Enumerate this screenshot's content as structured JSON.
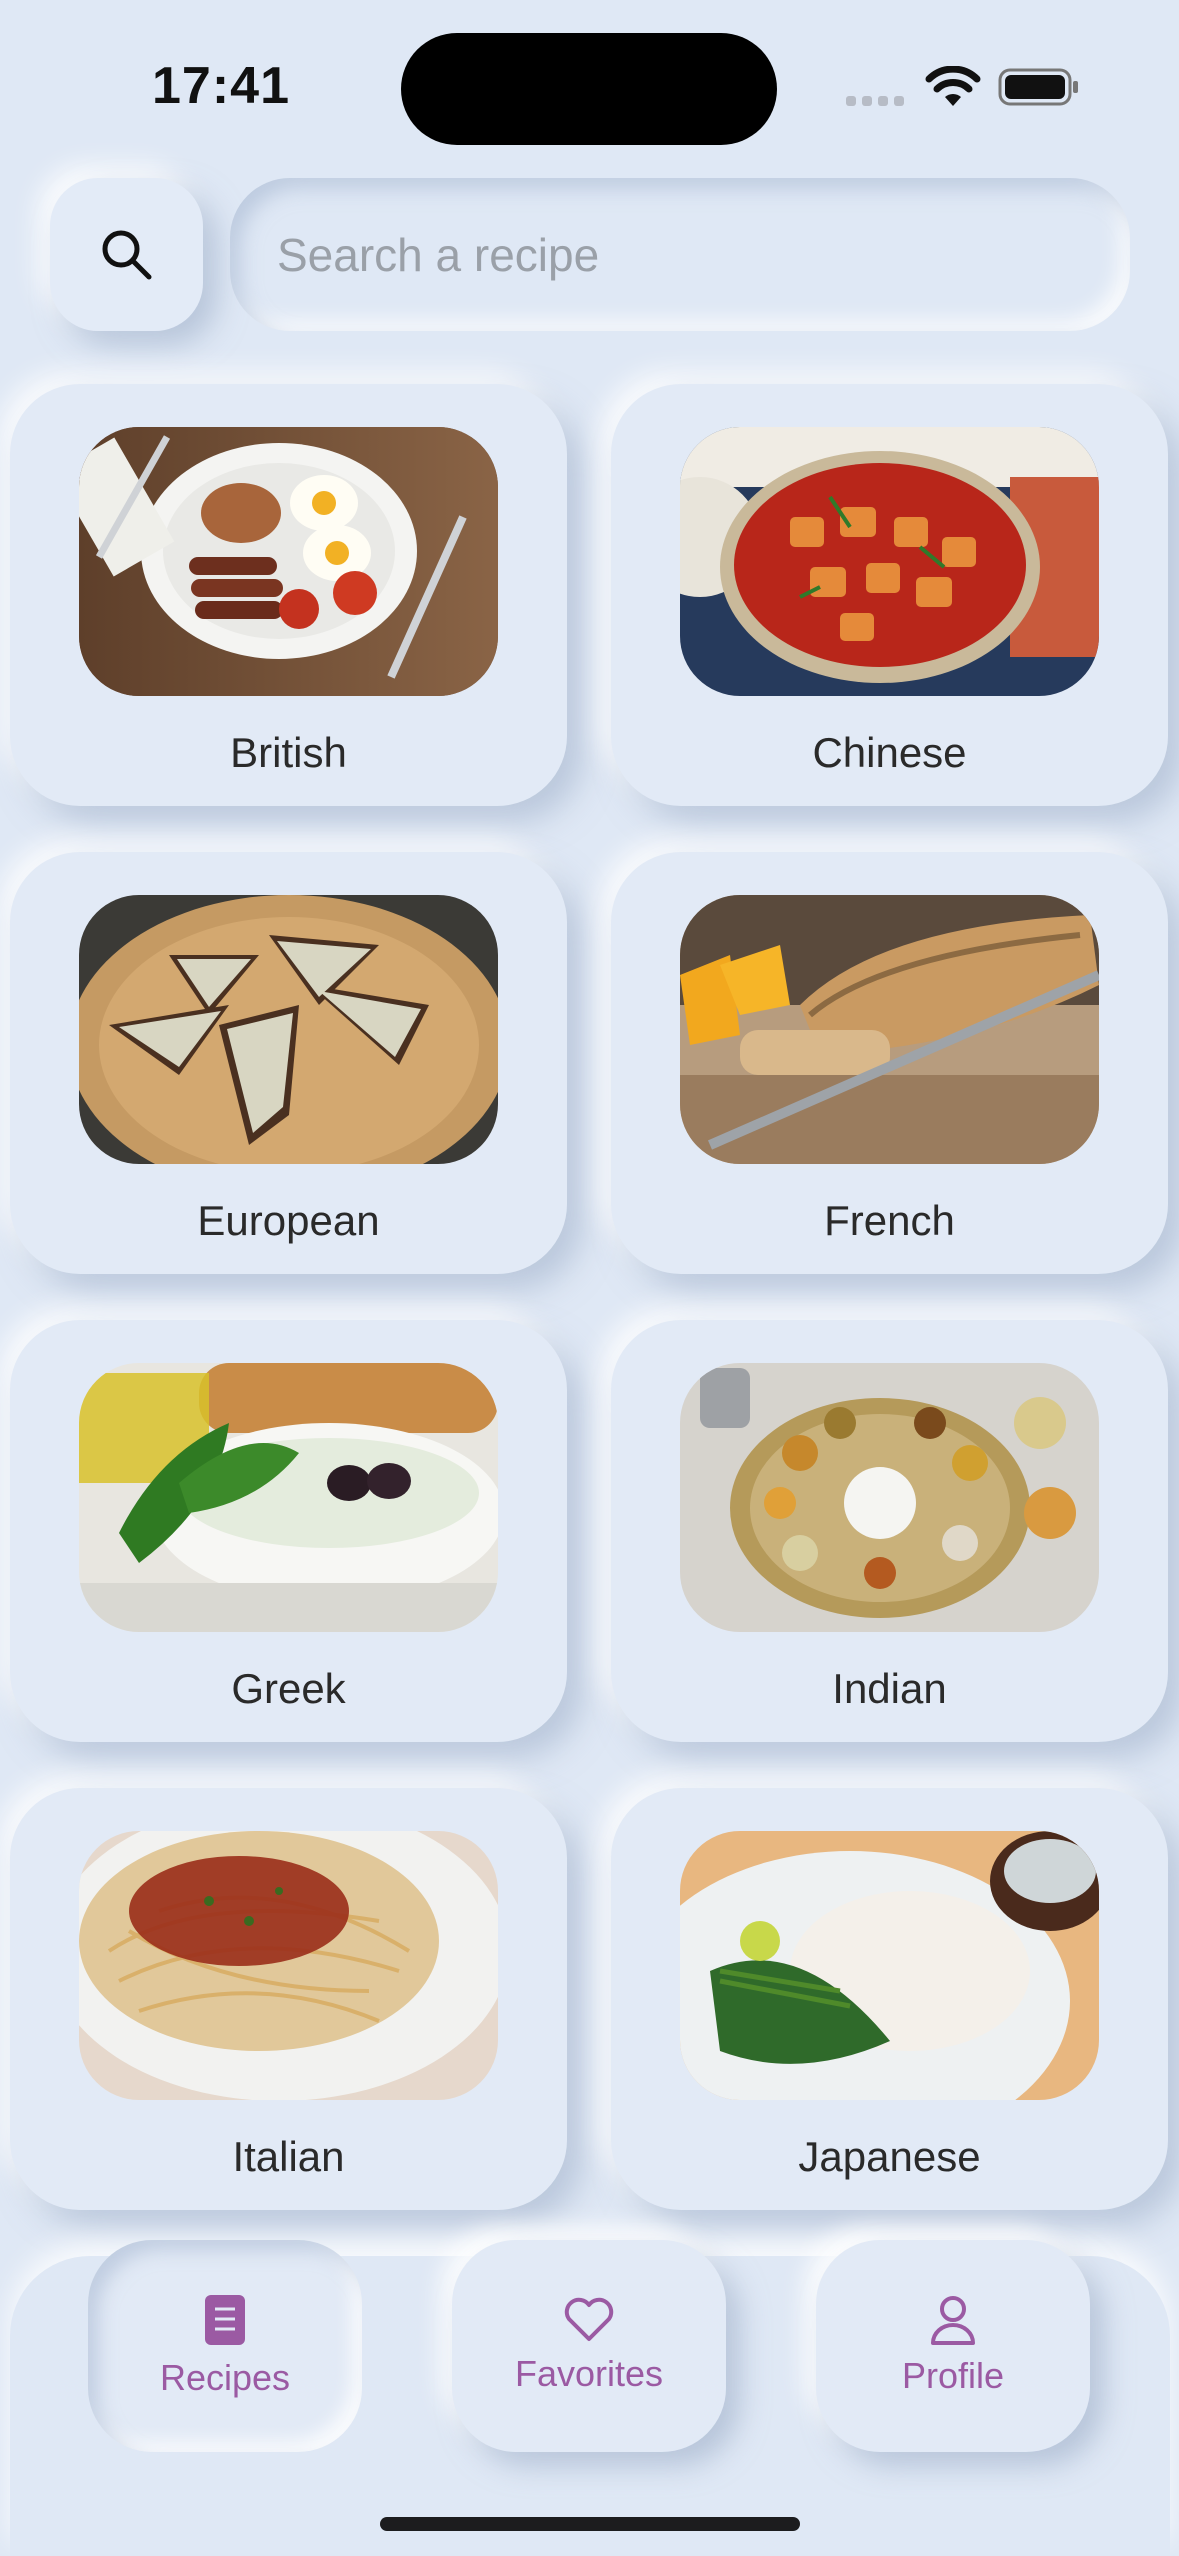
{
  "status_bar": {
    "time": "17:41",
    "icons": [
      "cellular-signal-icon",
      "wifi-icon",
      "battery-icon"
    ]
  },
  "search": {
    "icon": "search-icon",
    "placeholder": "Search a recipe",
    "value": ""
  },
  "cuisines": [
    {
      "label": "British",
      "image": "english breakfast plate"
    },
    {
      "label": "Chinese",
      "image": "mapo tofu bowl"
    },
    {
      "label": "European",
      "image": "open sandwiches on board"
    },
    {
      "label": "French",
      "image": "baguette with knife"
    },
    {
      "label": "Greek",
      "image": "tzatziki with olives"
    },
    {
      "label": "Indian",
      "image": "thali platter"
    },
    {
      "label": "Italian",
      "image": "spaghetti bolognese"
    },
    {
      "label": "Japanese",
      "image": "sashimi plate"
    }
  ],
  "tabs": [
    {
      "label": "Recipes",
      "icon": "recipe-book-icon",
      "active": true
    },
    {
      "label": "Favorites",
      "icon": "heart-icon",
      "active": false
    },
    {
      "label": "Profile",
      "icon": "person-icon",
      "active": false
    }
  ],
  "colors": {
    "background": "#dfe8f5",
    "accent": "#9b5aa3",
    "text": "#2a2a2a",
    "placeholder": "#9aa0a8"
  }
}
